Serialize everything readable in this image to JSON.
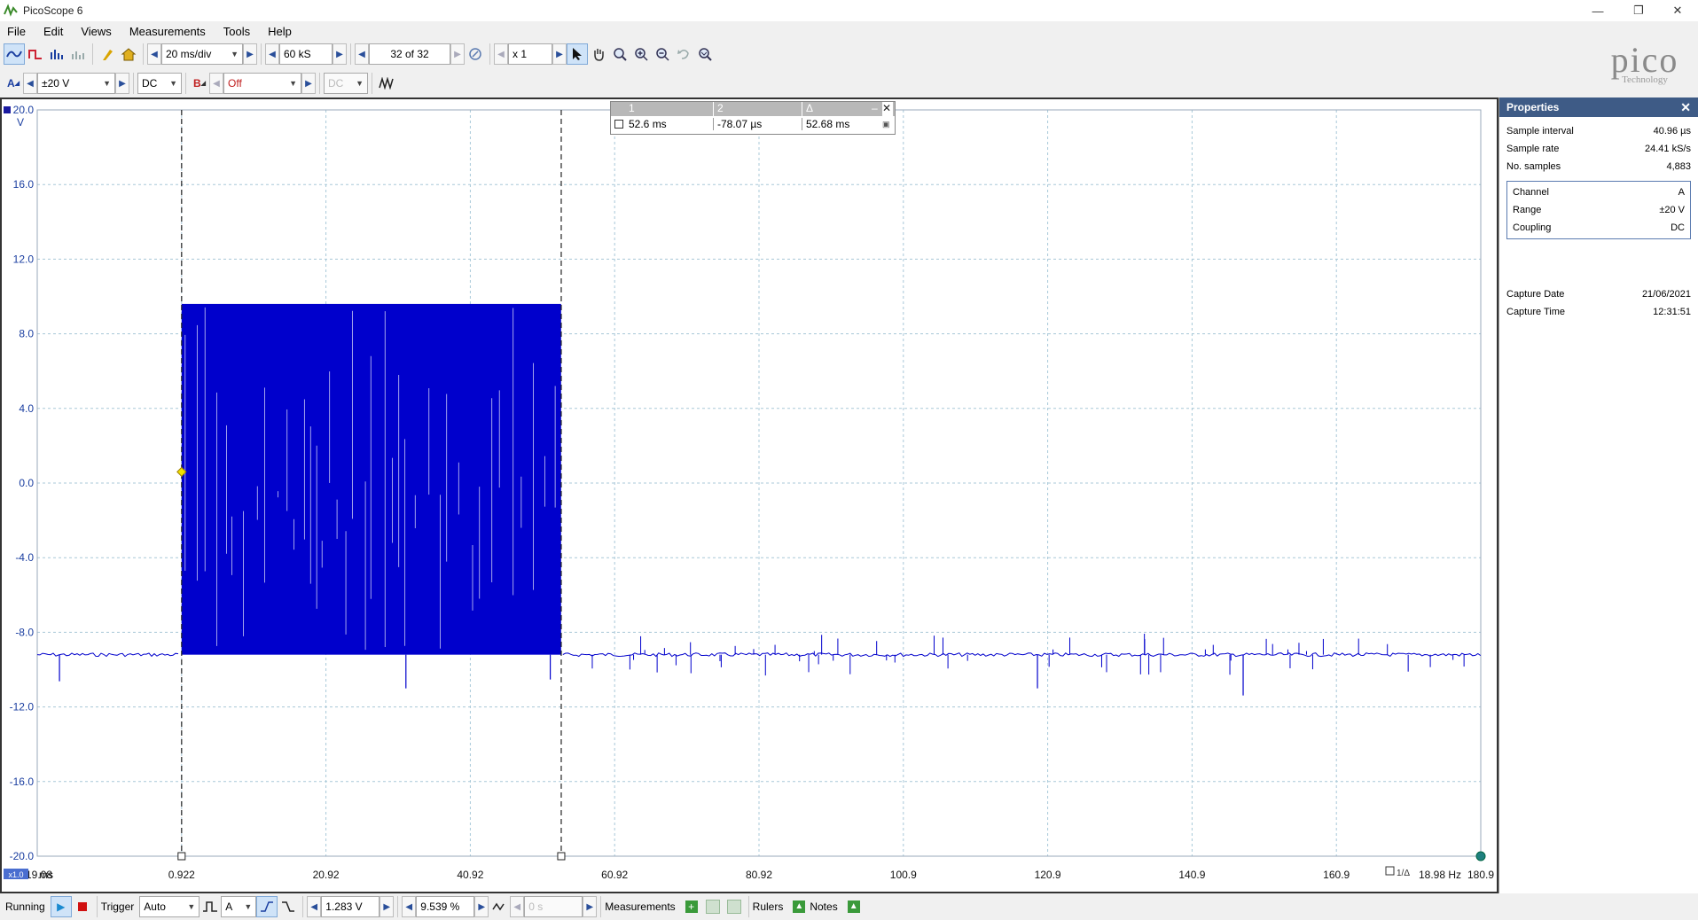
{
  "window": {
    "title": "PicoScope 6"
  },
  "menu": [
    "File",
    "Edit",
    "Views",
    "Measurements",
    "Tools",
    "Help"
  ],
  "toolbar": {
    "timebase": "20 ms/div",
    "samples": "60 kS",
    "buffer": "32 of 32",
    "zoom": "x 1"
  },
  "channel_bar": {
    "a_label": "A",
    "a_range": "±20 V",
    "a_coupling": "DC",
    "b_label": "B",
    "b_range": "Off",
    "b_coupling": "DC"
  },
  "logo": {
    "name": "pico",
    "sub": "Technology"
  },
  "ruler_table": {
    "headers": [
      "1",
      "2",
      "Δ"
    ],
    "values": [
      "52.6 ms",
      "-78.07 µs",
      "52.68 ms"
    ]
  },
  "properties": {
    "title": "Properties",
    "rows1": [
      {
        "label": "Sample interval",
        "value": "40.96 µs"
      },
      {
        "label": "Sample rate",
        "value": "24.41 kS/s"
      },
      {
        "label": "No. samples",
        "value": "4,883"
      }
    ],
    "rows2": [
      {
        "label": "Channel",
        "value": "A"
      },
      {
        "label": "Range",
        "value": "±20 V"
      },
      {
        "label": "Coupling",
        "value": "DC"
      }
    ],
    "rows3": [
      {
        "label": "Capture Date",
        "value": "21/06/2021"
      },
      {
        "label": "Capture Time",
        "value": "12:31:51"
      }
    ]
  },
  "statusbar": {
    "running": "Running",
    "trigger": "Trigger",
    "trigger_mode": "Auto",
    "trigger_source": "A",
    "threshold": "1.283 V",
    "pretrigger": "9.539 %",
    "delay": "0 s",
    "measurements": "Measurements",
    "rulers": "Rulers",
    "notes": "Notes"
  },
  "chart_data": {
    "type": "line",
    "ylabel_unit": "V",
    "xlabel_unit": "ms",
    "x_zoom_badge": "x1.0",
    "y_ticks": [
      "20.0",
      "16.0",
      "12.0",
      "8.0",
      "4.0",
      "0.0",
      "-4.0",
      "-8.0",
      "-12.0",
      "-16.0",
      "-20.0"
    ],
    "x_ticks": [
      "-19.08",
      "0.922",
      "20.92",
      "40.92",
      "60.92",
      "80.92",
      "100.9",
      "120.9",
      "140.9",
      "160.9",
      "180.9"
    ],
    "xlim": [
      -19.08,
      180.92
    ],
    "ylim": [
      -20,
      20
    ],
    "grid": true,
    "series": [
      {
        "color": "#0000cc",
        "x": [
          -19.08,
          0.72,
          0.92,
          53.5,
          53.7,
          180.92
        ],
        "y": [
          -9.2,
          -9.2,
          9.6,
          9.6,
          -9.2,
          -9.2
        ]
      }
    ],
    "burst": {
      "x_start": 0.92,
      "x_end": 53.5,
      "y_high": 9.6,
      "y_low": -9.2
    },
    "rulers": [
      {
        "x": 0.922
      },
      {
        "x": 53.52
      }
    ],
    "frequency_readout": "18.98 Hz"
  }
}
